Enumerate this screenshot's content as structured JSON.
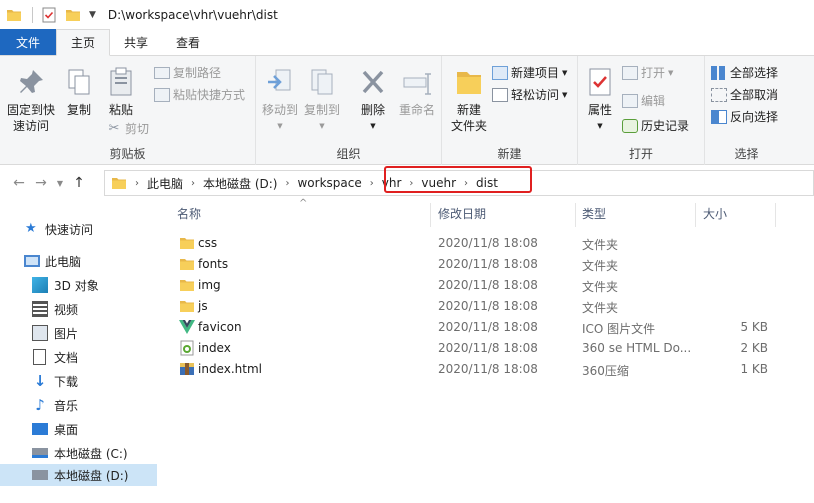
{
  "window": {
    "title_path": "D:\\workspace\\vhr\\vuehr\\dist"
  },
  "tabs": [
    {
      "label": "文件"
    },
    {
      "label": "主页"
    },
    {
      "label": "共享"
    },
    {
      "label": "查看"
    }
  ],
  "ribbon": {
    "clipboard": {
      "label": "剪贴板",
      "pin": "固定到快\n速访问",
      "copy": "复制",
      "paste": "粘贴",
      "copy_path": "复制路径",
      "paste_shortcut": "粘贴快捷方式",
      "cut": "剪切"
    },
    "organize": {
      "label": "组织",
      "move_to": "移动到",
      "copy_to": "复制到",
      "delete": "删除",
      "rename": "重命名"
    },
    "new": {
      "label": "新建",
      "new_folder": "新建\n文件夹",
      "new_item": "新建项目",
      "easy_access": "轻松访问"
    },
    "open": {
      "label": "打开",
      "properties": "属性",
      "open": "打开",
      "edit": "编辑",
      "history": "历史记录"
    },
    "select": {
      "label": "选择",
      "select_all": "全部选择",
      "select_none": "全部取消",
      "invert": "反向选择"
    }
  },
  "address": {
    "crumbs": [
      "此电脑",
      "本地磁盘 (D:)",
      "workspace",
      "vhr",
      "vuehr",
      "dist"
    ]
  },
  "nav": {
    "quick_access": "快速访问",
    "this_pc": "此电脑",
    "objects3d": "3D 对象",
    "videos": "视频",
    "pictures": "图片",
    "documents": "文档",
    "downloads": "下载",
    "music": "音乐",
    "desktop": "桌面",
    "disk_c": "本地磁盘 (C:)",
    "disk_d": "本地磁盘 (D:)"
  },
  "columns": {
    "name": "名称",
    "date": "修改日期",
    "type": "类型",
    "size": "大小"
  },
  "files": [
    {
      "name": "css",
      "date": "2020/11/8 18:08",
      "type": "文件夹",
      "size": "",
      "icon": "folder-icon"
    },
    {
      "name": "fonts",
      "date": "2020/11/8 18:08",
      "type": "文件夹",
      "size": "",
      "icon": "folder-icon"
    },
    {
      "name": "img",
      "date": "2020/11/8 18:08",
      "type": "文件夹",
      "size": "",
      "icon": "folder-icon"
    },
    {
      "name": "js",
      "date": "2020/11/8 18:08",
      "type": "文件夹",
      "size": "",
      "icon": "folder-icon"
    },
    {
      "name": "favicon",
      "date": "2020/11/8 18:08",
      "type": "ICO 图片文件",
      "size": "5 KB",
      "icon": "vue-logo-icon"
    },
    {
      "name": "index",
      "date": "2020/11/8 18:08",
      "type": "360 se HTML Do...",
      "size": "2 KB",
      "icon": "html-file-icon"
    },
    {
      "name": "index.html",
      "date": "2020/11/8 18:08",
      "type": "360压缩",
      "size": "1 KB",
      "icon": "archive-icon"
    }
  ],
  "colors": {
    "accent": "#1e68c0",
    "highlight": "#e02020",
    "selected": "#cce4f7"
  }
}
